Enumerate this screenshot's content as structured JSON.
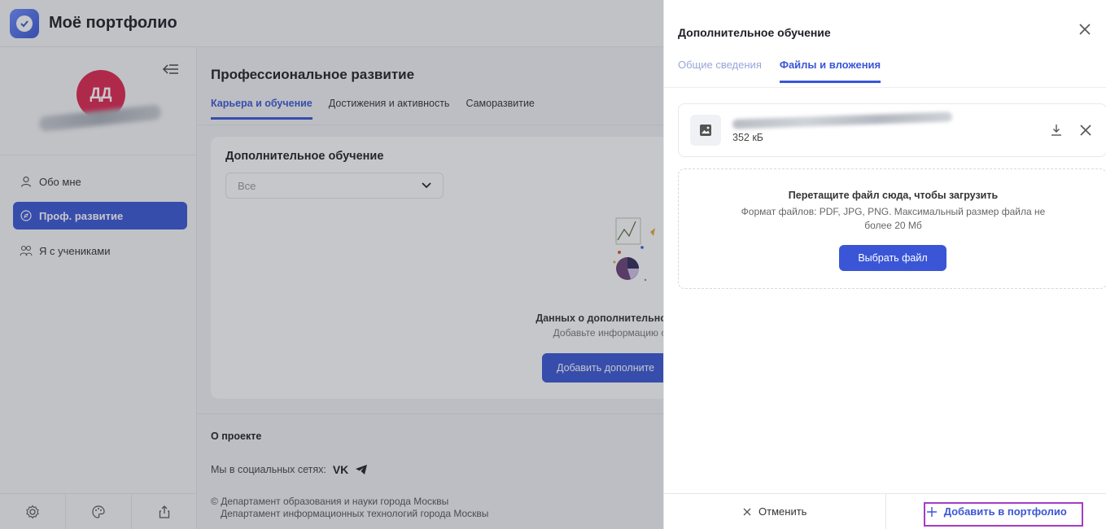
{
  "header": {
    "app_title": "Моё портфолио",
    "logo_icon": "checkmark-logo-icon"
  },
  "sidebar": {
    "avatar_initials": "ДД",
    "items": [
      {
        "label": "Обо мне",
        "icon": "person-icon",
        "active": false
      },
      {
        "label": "Проф. развитие",
        "icon": "compass-icon",
        "active": true
      },
      {
        "label": "Я с учениками",
        "icon": "people-icon",
        "active": false
      }
    ],
    "bottom_icons": [
      "settings-icon",
      "palette-icon",
      "share-icon"
    ]
  },
  "main": {
    "section_title": "Профессиональное развитие",
    "tabs": [
      {
        "label": "Карьера и обучение",
        "active": true
      },
      {
        "label": "Достижения и активность",
        "active": false
      },
      {
        "label": "Саморазвитие",
        "active": false
      }
    ],
    "card": {
      "title": "Дополнительное обучение",
      "filter_value": "Все",
      "empty_title": "Данных о дополнительно",
      "empty_subtitle": "Добавьте информацию о",
      "add_button": "Добавить дополните"
    },
    "footer": {
      "title": "О проекте",
      "social_label": "Мы в социальных сетях:",
      "vk_label": "VK",
      "copyright_line1": "Департамент образования и науки города Москвы",
      "copyright_line2": "Департамент информационных технологий города Москвы"
    }
  },
  "drawer": {
    "title": "Дополнительное обучение",
    "tabs": [
      {
        "label": "Общие сведения",
        "active": false
      },
      {
        "label": "Файлы и вложения",
        "active": true
      }
    ],
    "file": {
      "size": "352 кБ"
    },
    "dropzone": {
      "title": "Перетащите файл сюда, чтобы загрузить",
      "subtitle": "Формат файлов: PDF, JPG, PNG. Максимальный размер файла не более 20 Мб",
      "button": "Выбрать файл"
    },
    "footer": {
      "cancel": "Отменить",
      "add": "Добавить в портфолио"
    }
  },
  "colors": {
    "accent": "#3a56d6",
    "avatar": "#e0244f",
    "highlight": "#a53bc6"
  }
}
